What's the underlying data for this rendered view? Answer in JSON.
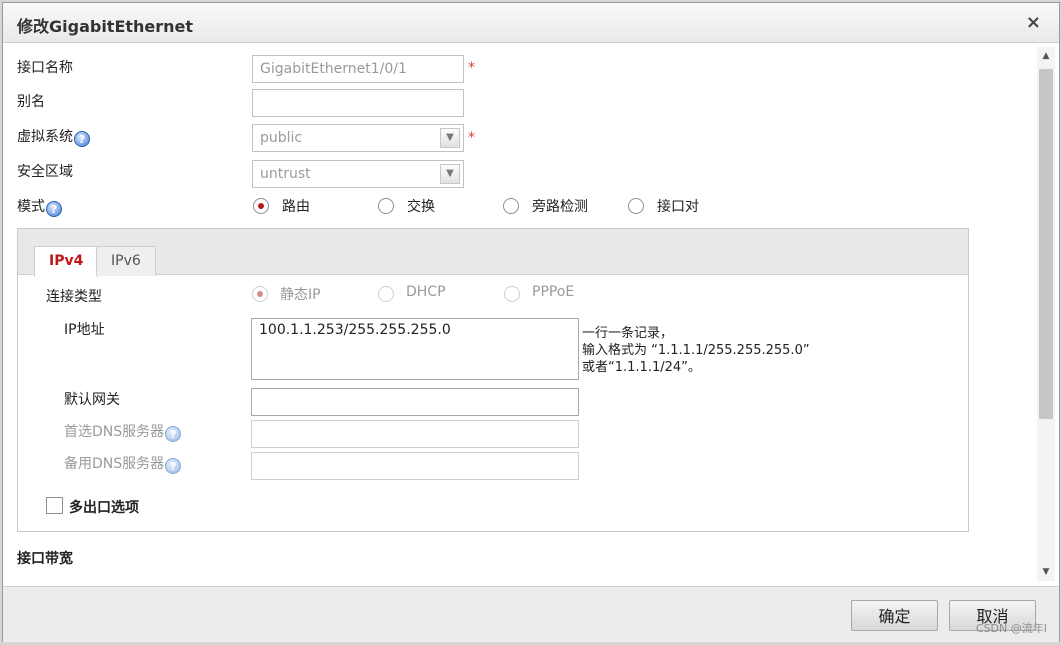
{
  "dialog": {
    "title": "修改GigabitEthernet",
    "close_icon": "×"
  },
  "form": {
    "interface_name": {
      "label": "接口名称",
      "value": "GigabitEthernet1/0/1",
      "required_mark": "*"
    },
    "alias": {
      "label": "别名",
      "value": ""
    },
    "virtual_system": {
      "label": "虚拟系统",
      "value": "public",
      "required_mark": "*"
    },
    "security_zone": {
      "label": "安全区域",
      "value": "untrust"
    },
    "mode": {
      "label": "模式",
      "options": [
        "路由",
        "交换",
        "旁路检测",
        "接口对"
      ],
      "selected": "路由"
    }
  },
  "tabs": [
    {
      "label": "IPv4",
      "active": true
    },
    {
      "label": "IPv6",
      "active": false
    }
  ],
  "ipv4": {
    "connection_type": {
      "label": "连接类型",
      "options": [
        "静态IP",
        "DHCP",
        "PPPoE"
      ],
      "selected": "静态IP"
    },
    "ip_address": {
      "label": "IP地址",
      "value": "100.1.1.253/255.255.255.0"
    },
    "hint": {
      "line1": "一行一条记录，",
      "line2": "输入格式为 “1.1.1.1/255.255.255.0”",
      "line3": "或者“1.1.1.1/24”。"
    },
    "default_gateway": {
      "label": "默认网关",
      "value": ""
    },
    "primary_dns": {
      "label": "首选DNS服务器",
      "value": ""
    },
    "secondary_dns": {
      "label": "备用DNS服务器",
      "value": ""
    },
    "multi_exit": {
      "label": "多出口选项",
      "checked": false
    }
  },
  "bandwidth": {
    "label": "接口带宽"
  },
  "footer": {
    "ok_label": "确定",
    "cancel_label": "取消",
    "watermark": "CSDN @流年I"
  },
  "icons": {
    "help_glyph": "?",
    "scroll_up": "▲",
    "scroll_down": "▼",
    "select_arrow": "▼"
  },
  "colors": {
    "accent": "#c01717",
    "required": "#e23b3b",
    "radio_selected": "#b31b1b"
  }
}
